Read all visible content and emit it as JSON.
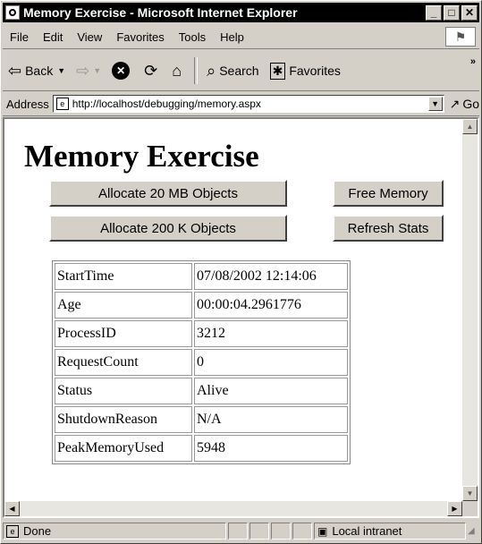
{
  "window": {
    "title": "Memory Exercise - Microsoft Internet Explorer",
    "controls": {
      "minimize": "_",
      "maximize": "□",
      "close": "✕"
    }
  },
  "menu": [
    "File",
    "Edit",
    "View",
    "Favorites",
    "Tools",
    "Help"
  ],
  "toolbar": {
    "back_label": "Back",
    "search_label": "Search",
    "favorites_label": "Favorites",
    "more": "»"
  },
  "address": {
    "label": "Address",
    "url": "http://localhost/debugging/memory.aspx",
    "go_label": "Go"
  },
  "page": {
    "title": "Memory Exercise",
    "buttons": {
      "allocate_20mb": "Allocate 20 MB Objects",
      "free_memory": "Free Memory",
      "allocate_200k": "Allocate 200 K Objects",
      "refresh_stats": "Refresh Stats"
    },
    "stats": [
      {
        "label": "StartTime",
        "value": "07/08/2002 12:14:06"
      },
      {
        "label": "Age",
        "value": "00:00:04.2961776"
      },
      {
        "label": "ProcessID",
        "value": "3212"
      },
      {
        "label": "RequestCount",
        "value": "0"
      },
      {
        "label": "Status",
        "value": "Alive"
      },
      {
        "label": "ShutdownReason",
        "value": "N/A"
      },
      {
        "label": "PeakMemoryUsed",
        "value": "5948"
      }
    ]
  },
  "status": {
    "text": "Done",
    "zone": "Local intranet"
  },
  "icons": {
    "app": "ie-page-icon",
    "back": "back-arrow-icon",
    "forward": "forward-arrow-icon",
    "stop": "stop-icon",
    "refresh": "refresh-icon",
    "home": "home-icon",
    "search": "search-icon",
    "favorites": "favorites-icon",
    "go": "go-arrow-icon"
  }
}
